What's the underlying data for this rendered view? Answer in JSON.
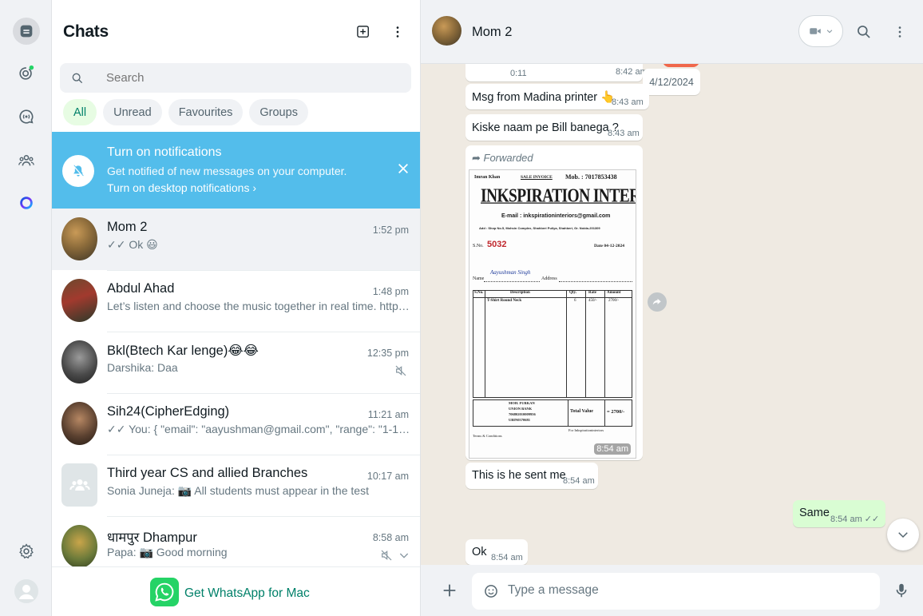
{
  "sidebar": {
    "title": "Chats",
    "search_placeholder": "Search",
    "filters": [
      "All",
      "Unread",
      "Favourites",
      "Groups"
    ],
    "notification": {
      "title": "Turn on notifications",
      "subtitle": "Get notified of new messages on your computer.",
      "link": "Turn on desktop notifications ›"
    },
    "chats": [
      {
        "name": "Mom 2",
        "time": "1:52 pm",
        "preview": "✓✓ Ok 😃",
        "muted": false
      },
      {
        "name": "Abdul Ahad",
        "time": "1:48 pm",
        "preview": "Let’s listen and choose the music together in real time. https://...",
        "muted": false
      },
      {
        "name": "Bkl(Btech Kar lenge)😂😂",
        "time": "12:35 pm",
        "preview": "Darshika: Daa",
        "muted": true
      },
      {
        "name": "Sih24(CipherEdging)",
        "time": "11:21 am",
        "preview": "✓✓ You: { \"email\": \"aayushman@gmail.com\", \"range\": \"1-12-24 ...",
        "muted": false
      },
      {
        "name": "Third year CS and allied Branches",
        "time": "10:17 am",
        "preview": "Sonia Juneja: 📷 All students must appear in the test",
        "muted": false
      },
      {
        "name": "धामपुर Dhampur",
        "time": "8:58 am",
        "preview": "Papa: 📷 Good morning",
        "muted": true
      }
    ],
    "get_app": "Get WhatsApp for Mac"
  },
  "conversation": {
    "contact_name": "Mom 2",
    "date_chip": "4/12/2024",
    "voice_duration": "0:11",
    "voice_time": "8:42 am",
    "messages": [
      {
        "text": "Msg from Madina printer 👆",
        "time": "8:43 am",
        "dir": "in"
      },
      {
        "text": "Kiske naam pe Bill banega ?",
        "time": "8:43 am",
        "dir": "in"
      },
      {
        "text": "This is he sent me",
        "time": "8:54 am",
        "dir": "in"
      },
      {
        "text": "Same",
        "time": "8:54 am ✓✓",
        "dir": "out"
      },
      {
        "text": "Ok",
        "time": "8:54 am",
        "dir": "in"
      }
    ],
    "forwarded": {
      "label": "➦ Forwarded",
      "time": "8:54 am",
      "invoice": {
        "owner": "Imran Khan",
        "kind": "SALE INVOICE",
        "mobile": "Mob. : 7017853438",
        "company": "INKSPIRATION INTERIOR",
        "email": "E-mail : inkspirationinteriors@gmail.com",
        "address": "Add : Shop No.5, Mohsin Complex, Shahberi Puliya, Shahberi, Gr. Noida-201309",
        "sno_label": "S.No.",
        "sno": "5032",
        "date": "Date 04-12-2024",
        "name_label": "Name",
        "name": "Aayushman Singh",
        "address_label": "Address",
        "cols": [
          "S.No.",
          "Description",
          "Qty.",
          "Rate",
          "Amount"
        ],
        "item": "T-Shirt Round Neck",
        "qty": "6",
        "rate": "450/-",
        "amount": "2700/-",
        "bank_name": "MOH. FURKAN",
        "bank": "UNION BANK",
        "acno": "706802010009956",
        "ifsc": "UBIN0570681",
        "total_label": "Total Value",
        "total": "= 2700/-",
        "sign": "For Inkspirationinteriors",
        "terms": "Terms & Conditions"
      }
    },
    "composer_placeholder": "Type a message"
  }
}
